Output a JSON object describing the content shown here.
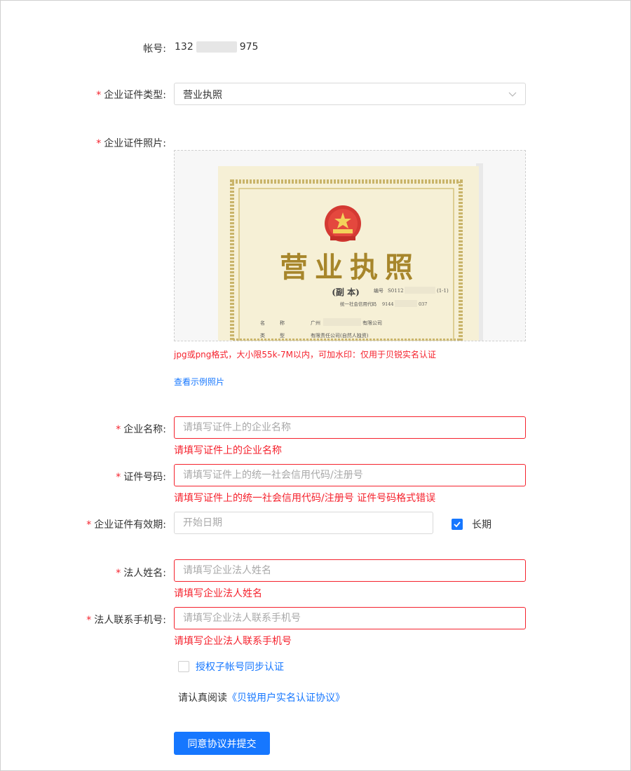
{
  "account": {
    "label": "帐号:",
    "value_prefix": "132",
    "value_suffix": "975"
  },
  "cert_type": {
    "label": "企业证件类型:",
    "value": "营业执照"
  },
  "cert_photo": {
    "label": "企业证件照片:",
    "image": {
      "title": "营业执照",
      "subtitle": "(副 本)",
      "serial_label": "编号",
      "serial_prefix": "S0112",
      "serial_suffix": "(1-1)",
      "credit_label": "统一社会信用代码",
      "credit_prefix": "9144",
      "credit_suffix": "037",
      "name_label": "名　　　称",
      "name_prefix": "广州",
      "name_suffix": "有限公司",
      "type_label": "类　　　型",
      "type_value": "有限责任公司(自然人独资)"
    },
    "hint": "jpg或png格式，大小限55k-7M以内，可加水印：仅用于贝锐实名认证",
    "example_link": "查看示例照片"
  },
  "company_name": {
    "label": "企业名称:",
    "placeholder": "请填写证件上的企业名称",
    "error": "请填写证件上的企业名称"
  },
  "cert_number": {
    "label": "证件号码:",
    "placeholder": "请填写证件上的统一社会信用代码/注册号",
    "error": "请填写证件上的统一社会信用代码/注册号 证件号码格式错误"
  },
  "validity": {
    "label": "企业证件有效期:",
    "placeholder": "开始日期",
    "long_term_label": "长期",
    "long_term_checked": true
  },
  "legal_name": {
    "label": "法人姓名:",
    "placeholder": "请填写企业法人姓名",
    "error": "请填写企业法人姓名"
  },
  "legal_phone": {
    "label": "法人联系手机号:",
    "placeholder": "请填写企业法人联系手机号",
    "error": "请填写企业法人联系手机号"
  },
  "sub_account": {
    "label": "授权子帐号同步认证",
    "checked": false
  },
  "agreement": {
    "prefix": "请认真阅读",
    "link": "《贝锐用户实名认证协议》"
  },
  "submit_label": "同意协议并提交",
  "colors": {
    "primary": "#1677ff",
    "error": "#f5222d"
  }
}
